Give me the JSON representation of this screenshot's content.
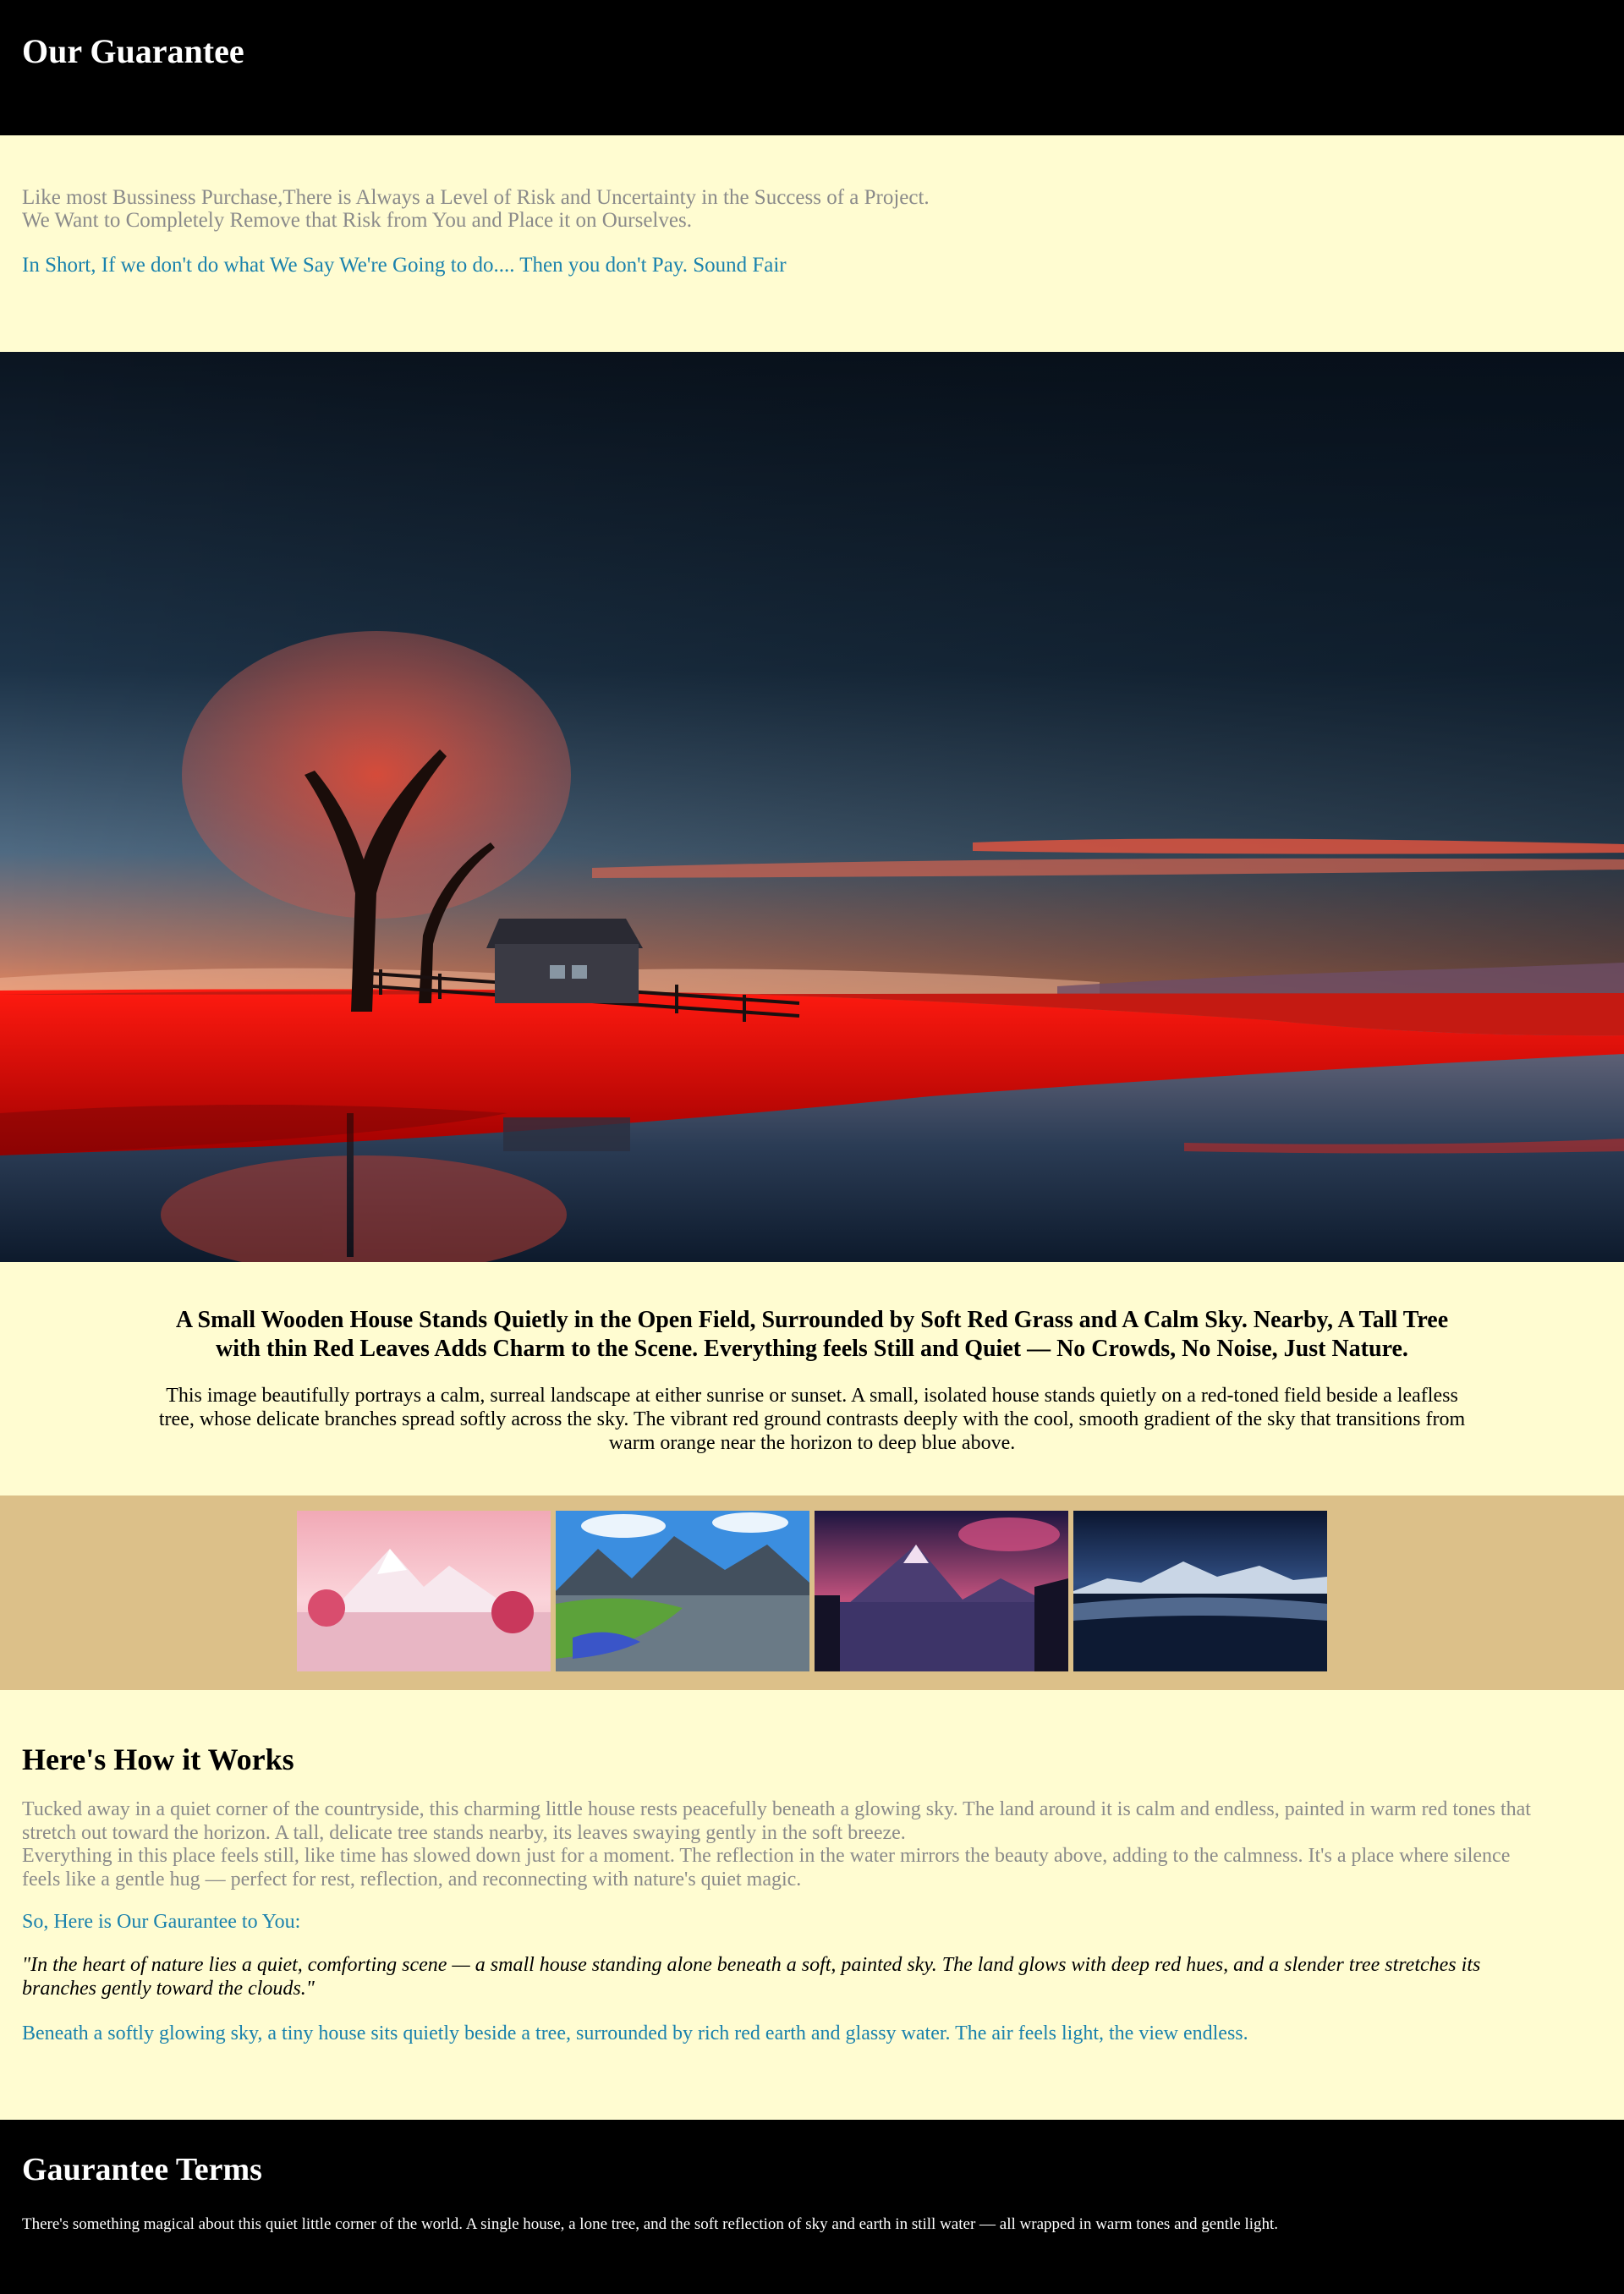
{
  "header": {
    "title": "Our Guarantee"
  },
  "intro": {
    "line1": "Like most Bussiness Purchase,There is Always a Level of Risk and Uncertainty in the Success of a Project.",
    "line2": "We Want to Completely Remove that Risk from You and Place it on Ourselves.",
    "highlight": "In Short, If we don't do what We Say We're Going to do.... Then you don't Pay. Sound Fair"
  },
  "description": {
    "heading": "A Small Wooden House Stands Quietly in the Open Field, Surrounded by Soft Red Grass and A Calm Sky. Nearby, A Tall Tree with thin Red Leaves Adds Charm to the Scene. Everything feels Still and Quiet — No Crowds, No Noise, Just Nature.",
    "body": "This image beautifully portrays a calm, surreal landscape at either sunrise or sunset. A small, isolated house stands quietly on a red-toned field beside a leafless tree, whose delicate branches spread softly across the sky. The vibrant red ground contrasts deeply with the cool, smooth gradient of the sky that transitions from warm orange near the horizon to deep blue above."
  },
  "how": {
    "title": "Here's How it Works",
    "para1": "Tucked away in a quiet corner of the countryside, this charming little house rests peacefully beneath a glowing sky. The land around it is calm and endless, painted in warm red tones that stretch out toward the horizon. A tall, delicate tree stands nearby, its leaves swaying gently in the soft breeze.",
    "para2": "Everything in this place feels still, like time has slowed down just for a moment. The reflection in the water mirrors the beauty above, adding to the calmness. It's a place where silence feels like a gentle hug — perfect for rest, reflection, and reconnecting with nature's quiet magic.",
    "subheading": "So, Here is Our Gaurantee to You:",
    "quote": "\"In the heart of nature lies a quiet, comforting scene — a small house standing alone beneath a soft, painted sky. The land glows with deep red hues, and a slender tree stretches its branches gently toward the clouds.\"",
    "closing": "Beneath a softly glowing sky, a tiny house sits quietly beside a tree, surrounded by rich red earth and glassy water. The air feels light, the view endless."
  },
  "footer": {
    "title": "Gaurantee Terms",
    "text": "There's something magical about this quiet little corner of the world. A single house, a lone tree, and the soft reflection of sky and earth in still water — all wrapped in warm tones and gentle light."
  },
  "colors": {
    "background": "#fffcd1",
    "header_bg": "#000000",
    "accent_blue": "#1a82ad",
    "muted_text": "#8a8a8a",
    "gallery_bg": "#dcc089"
  }
}
